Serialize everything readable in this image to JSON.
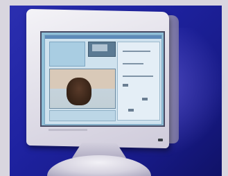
{
  "photo": {
    "subject": "crt-monitor-with-video-call-app",
    "colors": {
      "backdrop": "#1e22a0",
      "bezel": "#e3e1ea",
      "screen": "#8fc0d8"
    },
    "icons": [
      "crt-monitor-icon",
      "power-led-icon"
    ]
  }
}
